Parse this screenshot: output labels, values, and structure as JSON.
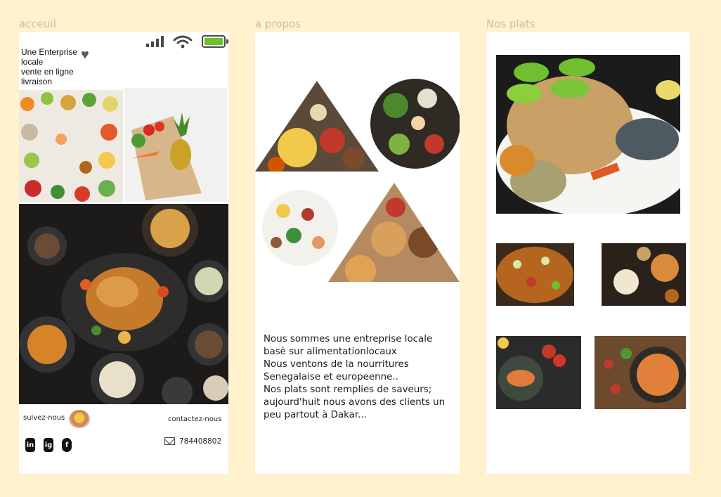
{
  "frames": {
    "home": {
      "label": "acceuil",
      "tagline": [
        "Une Enterprise",
        "locale",
        "vente en ligne",
        "livraison"
      ],
      "follow_label": "suivez-nous",
      "contact_label": "contactez-nous",
      "phone": "784408802",
      "social": [
        "in",
        "ig",
        "f"
      ],
      "status": {
        "signal_icon": "signal-icon",
        "wifi_icon": "wifi-icon",
        "battery_icon": "battery-icon",
        "battery_level": 1.0
      }
    },
    "about": {
      "label": "a propos",
      "text_lines": [
        "Nous sommes une entreprise locale",
        "basè sur alimentationlocaux",
        "Nous ventons de la nourritures",
        "Senegalaise et europeenne..",
        "Nos plats sont remplies de saveurs;",
        "aujourd'huit nous avons des clients un",
        "peu partout à Dakar..."
      ]
    },
    "dishes": {
      "label": "Nos plats"
    }
  },
  "colors": {
    "background": "#fff2cc",
    "frame": "#ffffff",
    "label": "#c7bfa5",
    "battery": "#6fbf2e"
  }
}
